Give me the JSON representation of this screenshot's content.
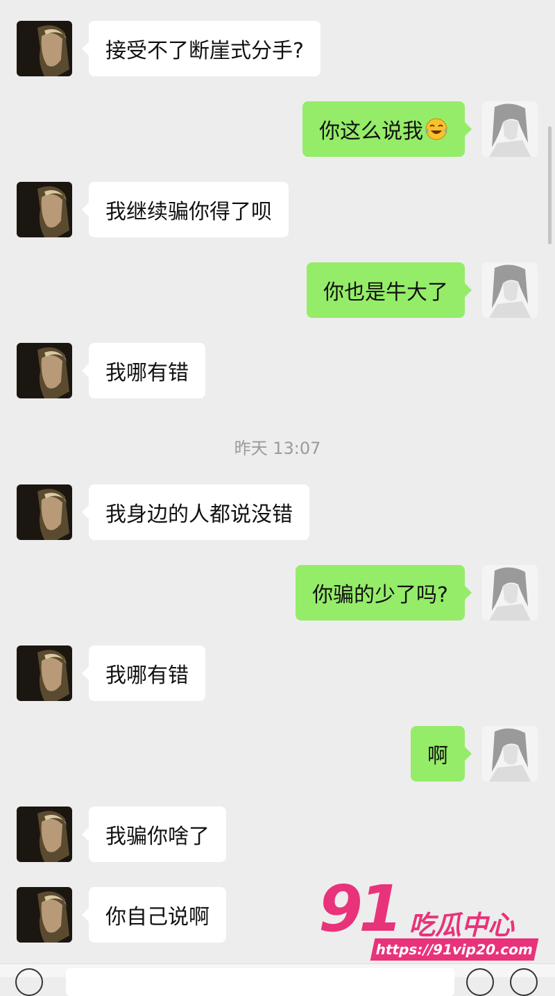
{
  "chat": {
    "timestamp": "昨天 13:07",
    "messages": [
      {
        "side": "left",
        "text": "接受不了断崖式分手?"
      },
      {
        "side": "right",
        "text": "你这么说我",
        "emoji": "tears-of-joy-emoji"
      },
      {
        "side": "left",
        "text": "我继续骗你得了呗"
      },
      {
        "side": "right",
        "text": "你也是牛大了"
      },
      {
        "side": "left",
        "text": "我哪有错"
      },
      {
        "side": "left",
        "text": "我身边的人都说没错"
      },
      {
        "side": "right",
        "text": "你骗的少了吗?"
      },
      {
        "side": "left",
        "text": "我哪有错"
      },
      {
        "side": "right",
        "text": "啊"
      },
      {
        "side": "left",
        "text": "我骗你啥了"
      },
      {
        "side": "left",
        "text": "你自己说啊"
      }
    ]
  },
  "watermark": {
    "number": "91",
    "title": "吃瓜中心",
    "url": "https://91vip20.com"
  },
  "colors": {
    "background": "#ededed",
    "sent_bubble": "#95ec69",
    "received_bubble": "#ffffff",
    "watermark": "#e8337a"
  }
}
